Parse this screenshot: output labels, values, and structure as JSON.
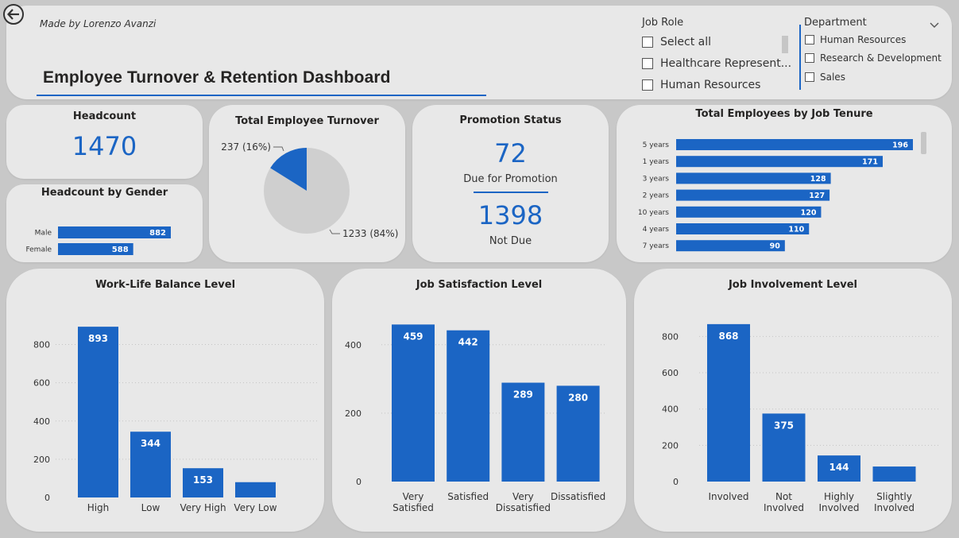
{
  "header": {
    "made_by": "Made by Lorenzo Avanzi",
    "title": "Employee Turnover & Retention Dashboard"
  },
  "slicers": {
    "job_role": {
      "title": "Job Role",
      "items": [
        "Select all",
        "Healthcare Represent...",
        "Human Resources"
      ]
    },
    "department": {
      "title": "Department",
      "items": [
        "Human Resources",
        "Research & Development",
        "Sales"
      ]
    }
  },
  "headcount": {
    "title": "Headcount",
    "value": "1470"
  },
  "promotion": {
    "title": "Promotion Status",
    "due_value": "72",
    "due_label": "Due for Promotion",
    "not_due_value": "1398",
    "not_due_label": "Not Due"
  },
  "colors": {
    "accent": "#1b65c4",
    "pie_rest": "#cfcfcf",
    "card": "#e8e8e8",
    "background": "#c8c8c8"
  },
  "chart_data": [
    {
      "id": "gender",
      "type": "bar",
      "orientation": "horizontal",
      "title": "Headcount by Gender",
      "categories": [
        "Male",
        "Female"
      ],
      "values": [
        882,
        588
      ],
      "value_labels": [
        "882",
        "588"
      ]
    },
    {
      "id": "turnover",
      "type": "pie",
      "title": "Total Employee Turnover",
      "values": [
        237,
        1233
      ],
      "value_labels": [
        "237 (16%)",
        "1233 (84%)"
      ]
    },
    {
      "id": "tenure",
      "type": "bar",
      "orientation": "horizontal",
      "title": "Total Employees by Job Tenure",
      "categories": [
        "5 years",
        "1 years",
        "3 years",
        "2 years",
        "10 years",
        "4 years",
        "7 years"
      ],
      "values": [
        196,
        171,
        128,
        127,
        120,
        110,
        90
      ],
      "value_labels": [
        "196",
        "171",
        "128",
        "127",
        "120",
        "110",
        "90"
      ]
    },
    {
      "id": "worklife",
      "type": "bar",
      "title": "Work-Life Balance Level",
      "categories": [
        "High",
        "Low",
        "Very High",
        "Very Low"
      ],
      "values": [
        893,
        344,
        153,
        80
      ],
      "value_labels": [
        "893",
        "344",
        "153",
        ""
      ],
      "ylim": [
        0,
        960
      ],
      "yticks": [
        0,
        200,
        400,
        600,
        800
      ],
      "ytick_labels": [
        "0",
        "200",
        "400",
        "600",
        "800"
      ],
      "grid": true
    },
    {
      "id": "satisfaction",
      "type": "bar",
      "title": "Job Satisfaction Level",
      "categories": [
        "Very Satisfied",
        "Satisfied",
        "Very Dissatisfied",
        "Dissatisfied"
      ],
      "values": [
        459,
        442,
        289,
        280
      ],
      "value_labels": [
        "459",
        "442",
        "289",
        "280"
      ],
      "ylim": [
        0,
        490
      ],
      "yticks": [
        0,
        200,
        400
      ],
      "ytick_labels": [
        "0",
        "200",
        "400"
      ],
      "grid": true
    },
    {
      "id": "involvement",
      "type": "bar",
      "title": "Job Involvement Level",
      "categories": [
        "Involved",
        "Not Involved",
        "Highly Involved",
        "Slightly Involved"
      ],
      "values": [
        868,
        375,
        144,
        83
      ],
      "value_labels": [
        "868",
        "375",
        "144",
        ""
      ],
      "ylim": [
        0,
        920
      ],
      "yticks": [
        0,
        200,
        400,
        600,
        800
      ],
      "ytick_labels": [
        "0",
        "200",
        "400",
        "600",
        "800"
      ],
      "grid": true
    }
  ]
}
